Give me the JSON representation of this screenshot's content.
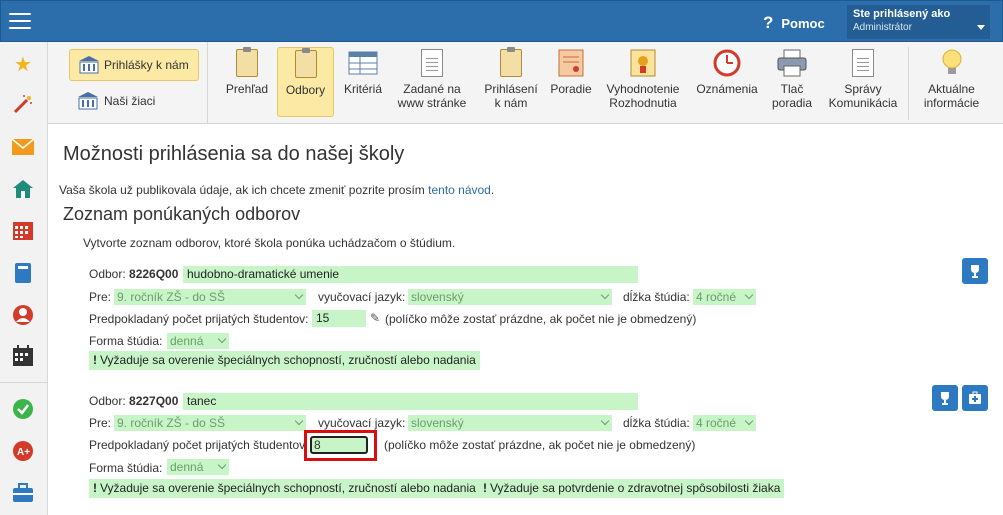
{
  "header": {
    "help_label": "Pomoc",
    "user_line1": "Ste prihlásený ako",
    "user_line2": "Administrátor"
  },
  "sidebar": {
    "icons": [
      "star-icon",
      "magic-wand-icon",
      "mail-icon",
      "home-icon",
      "calendar-grid-icon",
      "book-icon",
      "user-icon",
      "schedule-icon",
      "check-circle-icon",
      "a-plus-icon",
      "briefcase-icon"
    ]
  },
  "toolbar": {
    "prihlasky": "Prihlášky k nám",
    "ziaci": "Naši žiaci",
    "items": [
      {
        "label1": "Prehľad",
        "label2": ""
      },
      {
        "label1": "Odbory",
        "label2": ""
      },
      {
        "label1": "Kritériá",
        "label2": ""
      },
      {
        "label1": "Zadané na",
        "label2": "www stránke"
      },
      {
        "label1": "Prihlásení",
        "label2": "k nám"
      },
      {
        "label1": "Poradie",
        "label2": ""
      },
      {
        "label1": "Vyhodnotenie",
        "label2": "Rozhodnutia"
      },
      {
        "label1": "Oznámenia",
        "label2": ""
      },
      {
        "label1": "Tlač",
        "label2": "poradia"
      },
      {
        "label1": "Správy",
        "label2": "Komunikácia"
      },
      {
        "label1": "Aktuálne",
        "label2": "informácie"
      }
    ]
  },
  "main": {
    "title": "Možnosti prihlásenia sa do našej školy",
    "published_text": "Vaša škola už publikovala údaje, ak ich chcete zmeniť pozrite prosím ",
    "published_link": "tento návod",
    "published_end": ".",
    "subtitle": "Zoznam ponúkaných odborov",
    "intro": "Vytvorte zoznam odborov, ktoré škola ponúka uchádzačom o štúdium."
  },
  "labels": {
    "odbor": "Odbor:",
    "pre": "Pre:",
    "jazyk": "vyučovací jazyk:",
    "dlzka": "dĺžka štúdia:",
    "pocet": "Predpokladaný počet prijatých študentov:",
    "pocet_truncated": "Predpokladaný počet prijatých študentov",
    "pocet_note": "(políčko môže zostať prázdne, ak počet nie je obmedzený)",
    "forma": "Forma štúdia:"
  },
  "odbory": [
    {
      "code": "8226Q00",
      "name": "hudobno-dramatické umenie",
      "pre": "9. ročník ZŠ - do SŠ",
      "jazyk": "slovenský",
      "dlzka": "4 ročné",
      "pocet": "15",
      "forma": "denná",
      "requirements": [
        "Vyžaduje sa overenie špeciálnych schopností, zručností alebo nadania"
      ]
    },
    {
      "code": "8227Q00",
      "name": "tanec",
      "pre": "9. ročník ZŠ - do SŠ",
      "jazyk": "slovenský",
      "dlzka": "4 ročné",
      "pocet": "8",
      "forma": "denná",
      "requirements": [
        "Vyžaduje sa overenie špeciálnych schopností, zručností alebo nadania",
        "Vyžaduje sa potvrdenie o zdravotnej spôsobilosti žiaka"
      ]
    }
  ],
  "colors": {
    "topbar": "#2c6eab",
    "field_green": "#c8f5c8",
    "button_blue": "#2e7ac2",
    "highlight_red": "#d90d0d",
    "active_yellow": "#fbe9a4"
  }
}
